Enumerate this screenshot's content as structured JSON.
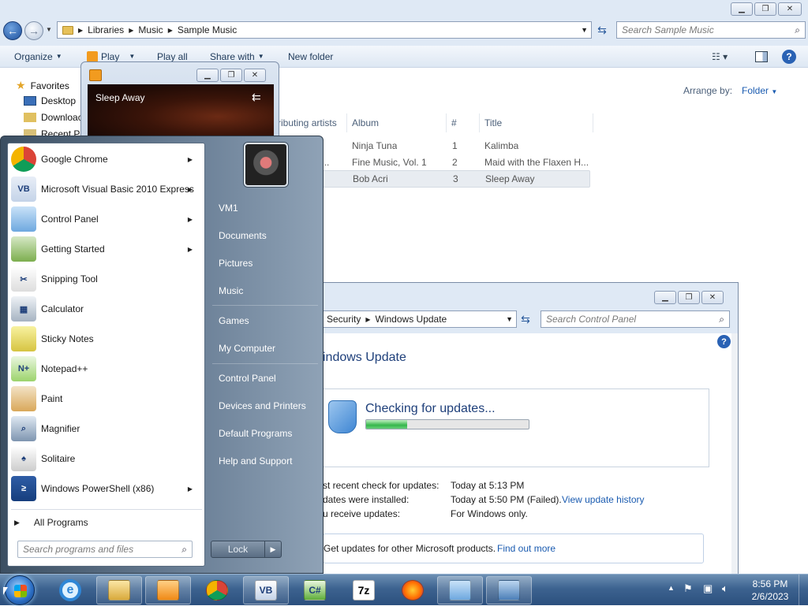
{
  "explorer": {
    "breadcrumb": [
      "Libraries",
      "Music",
      "Sample Music"
    ],
    "search_placeholder": "Search Sample Music",
    "toolbar": {
      "organize": "Organize",
      "play": "Play",
      "play_all": "Play all",
      "share_with": "Share with",
      "new_folder": "New folder"
    },
    "nav": {
      "favorites": "Favorites",
      "desktop": "Desktop",
      "downloads": "Downloac",
      "recent": "Recent Pl"
    },
    "arrange_by_label": "Arrange by:",
    "arrange_by_value": "Folder",
    "columns": {
      "artists": "ributing artists",
      "album": "Album",
      "num": "#",
      "title": "Title"
    },
    "rows": [
      {
        "artist": "",
        "album": "Ninja Tuna",
        "num": "1",
        "title": "Kalimba"
      },
      {
        "artist": "an...",
        "album": "Fine Music, Vol. 1",
        "num": "2",
        "title": "Maid with the Flaxen H..."
      },
      {
        "artist": "",
        "album": "Bob Acri",
        "num": "3",
        "title": "Sleep Away"
      }
    ]
  },
  "wmp": {
    "track": "Sleep Away"
  },
  "cpanel": {
    "breadcrumb": [
      "Security",
      "Windows Update"
    ],
    "search_placeholder": "Search Control Panel",
    "heading": "indows Update",
    "status": "Checking for updates...",
    "progress_fraction": 0.25,
    "info": [
      {
        "label": "st recent check for updates:",
        "value": "Today at 5:13 PM"
      },
      {
        "label": "dates were installed:",
        "value": "Today at 5:50 PM (Failed).",
        "link": "View update history"
      },
      {
        "label": "u receive updates:",
        "value": "For Windows only."
      }
    ],
    "other_products": "Get updates for other Microsoft products.",
    "find_out_more": "Find out more"
  },
  "start": {
    "programs": [
      {
        "label": "Google Chrome",
        "icon": "chrome-icon",
        "arrow": true
      },
      {
        "label": "Microsoft Visual Basic 2010 Express",
        "icon": "vb-icon",
        "arrow": true
      },
      {
        "label": "Control Panel",
        "icon": "control-panel-icon",
        "arrow": true
      },
      {
        "label": "Getting Started",
        "icon": "getting-started-icon",
        "arrow": true
      },
      {
        "label": "Snipping Tool",
        "icon": "scissors-icon",
        "arrow": false
      },
      {
        "label": "Calculator",
        "icon": "calculator-icon",
        "arrow": false
      },
      {
        "label": "Sticky Notes",
        "icon": "sticky-notes-icon",
        "arrow": false
      },
      {
        "label": "Notepad++",
        "icon": "notepadpp-icon",
        "arrow": false
      },
      {
        "label": "Paint",
        "icon": "paint-icon",
        "arrow": false
      },
      {
        "label": "Magnifier",
        "icon": "magnifier-icon",
        "arrow": false
      },
      {
        "label": "Solitaire",
        "icon": "solitaire-icon",
        "arrow": false
      },
      {
        "label": "Windows PowerShell (x86)",
        "icon": "powershell-icon",
        "arrow": true
      }
    ],
    "all_programs": "All Programs",
    "search_placeholder": "Search programs and files",
    "right_links": [
      "VM1",
      "Documents",
      "Pictures",
      "Music",
      "Games",
      "My Computer",
      "Control Panel",
      "Devices and Printers",
      "Default Programs",
      "Help and Support"
    ],
    "lock_label": "Lock"
  },
  "taskbar": {
    "time": "8:56 PM",
    "date": "2/6/2023",
    "apps": [
      "explorer-icon",
      "media-player-icon",
      "chrome-icon",
      "vb-icon",
      "csharp-icon",
      "7zip-icon",
      "firefox-icon",
      "control-panel-icon",
      "remote-desktop-icon"
    ]
  }
}
